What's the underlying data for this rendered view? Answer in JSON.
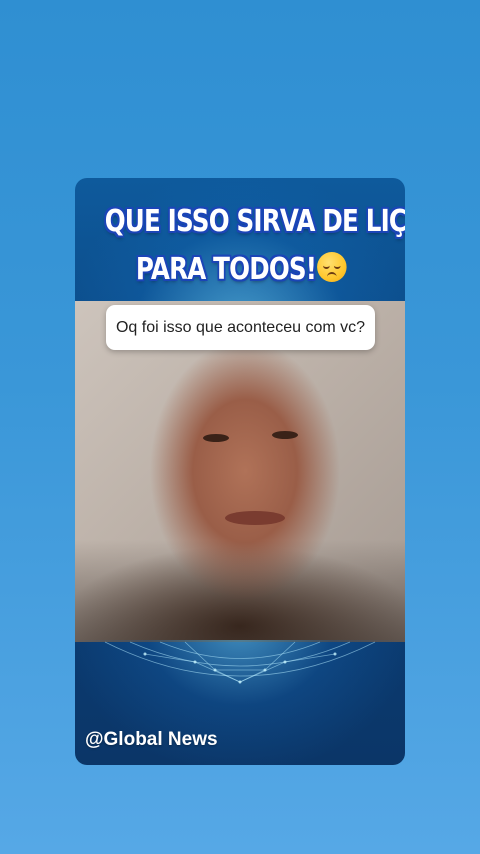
{
  "post": {
    "headline_line1": "QUE ISSO SIRVA DE LIÇÃO",
    "headline_line2": "PARA TODOS!",
    "headline_emoji": "disappointed-face-emoji",
    "question_sticker": "Oq foi isso que aconteceu com vc?",
    "handle": "@Global News"
  },
  "colors": {
    "background_top": "#2f8fd2",
    "background_bottom": "#56a8e6",
    "card_blue": "#0a3f78",
    "headline_outline": "#1b45b7",
    "headline_fill": "#ffffff"
  }
}
